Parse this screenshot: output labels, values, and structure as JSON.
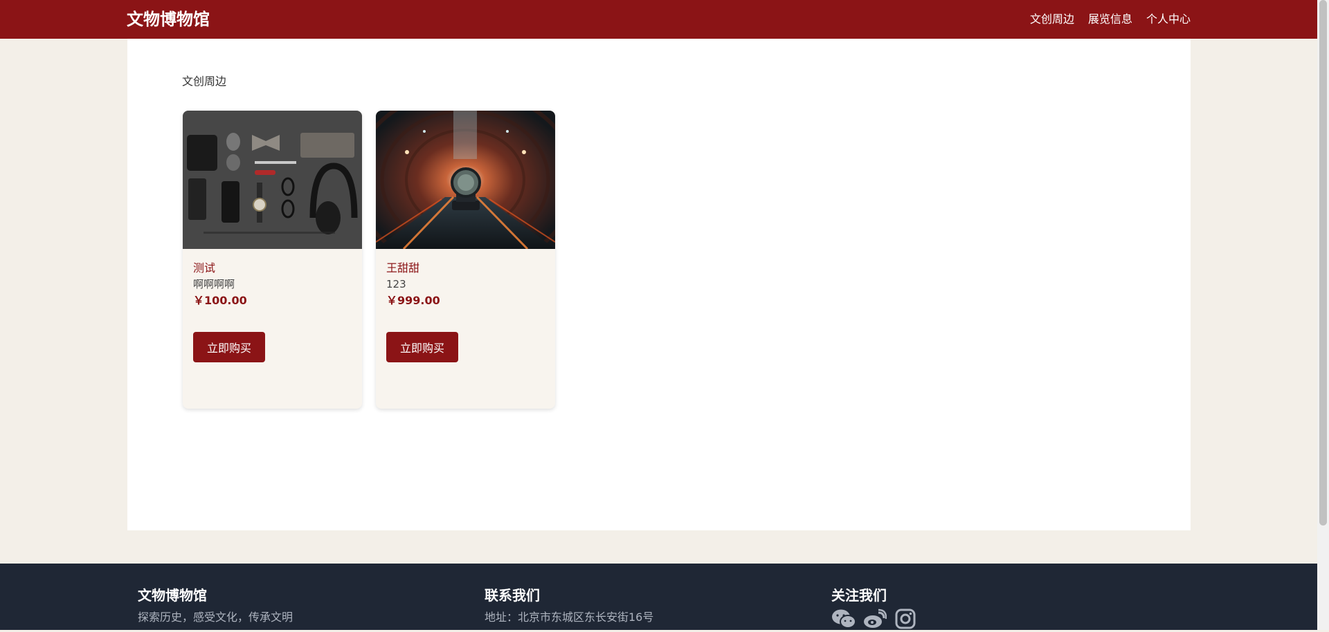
{
  "header": {
    "brand": "文物博物馆",
    "nav": [
      "文创周边",
      "展览信息",
      "个人中心"
    ]
  },
  "main": {
    "section_title": "文创周边",
    "products": [
      {
        "name": "测试",
        "desc": "啊啊啊啊",
        "price": "￥100.00",
        "buy_label": "立即购买"
      },
      {
        "name": "王甜甜",
        "desc": "123",
        "price": "￥999.00",
        "buy_label": "立即购买"
      }
    ]
  },
  "footer": {
    "col1": {
      "title": "文物博物馆",
      "text": "探索历史，感受文化，传承文明"
    },
    "col2": {
      "title": "联系我们",
      "text": "地址：北京市东城区东长安街16号"
    },
    "col3": {
      "title": "关注我们",
      "icons": [
        "wechat-icon",
        "weibo-icon",
        "instagram-icon"
      ]
    }
  },
  "colors": {
    "accent": "#8b1416",
    "footer_bg": "#1f2735",
    "page_bg": "#f3efe8"
  }
}
